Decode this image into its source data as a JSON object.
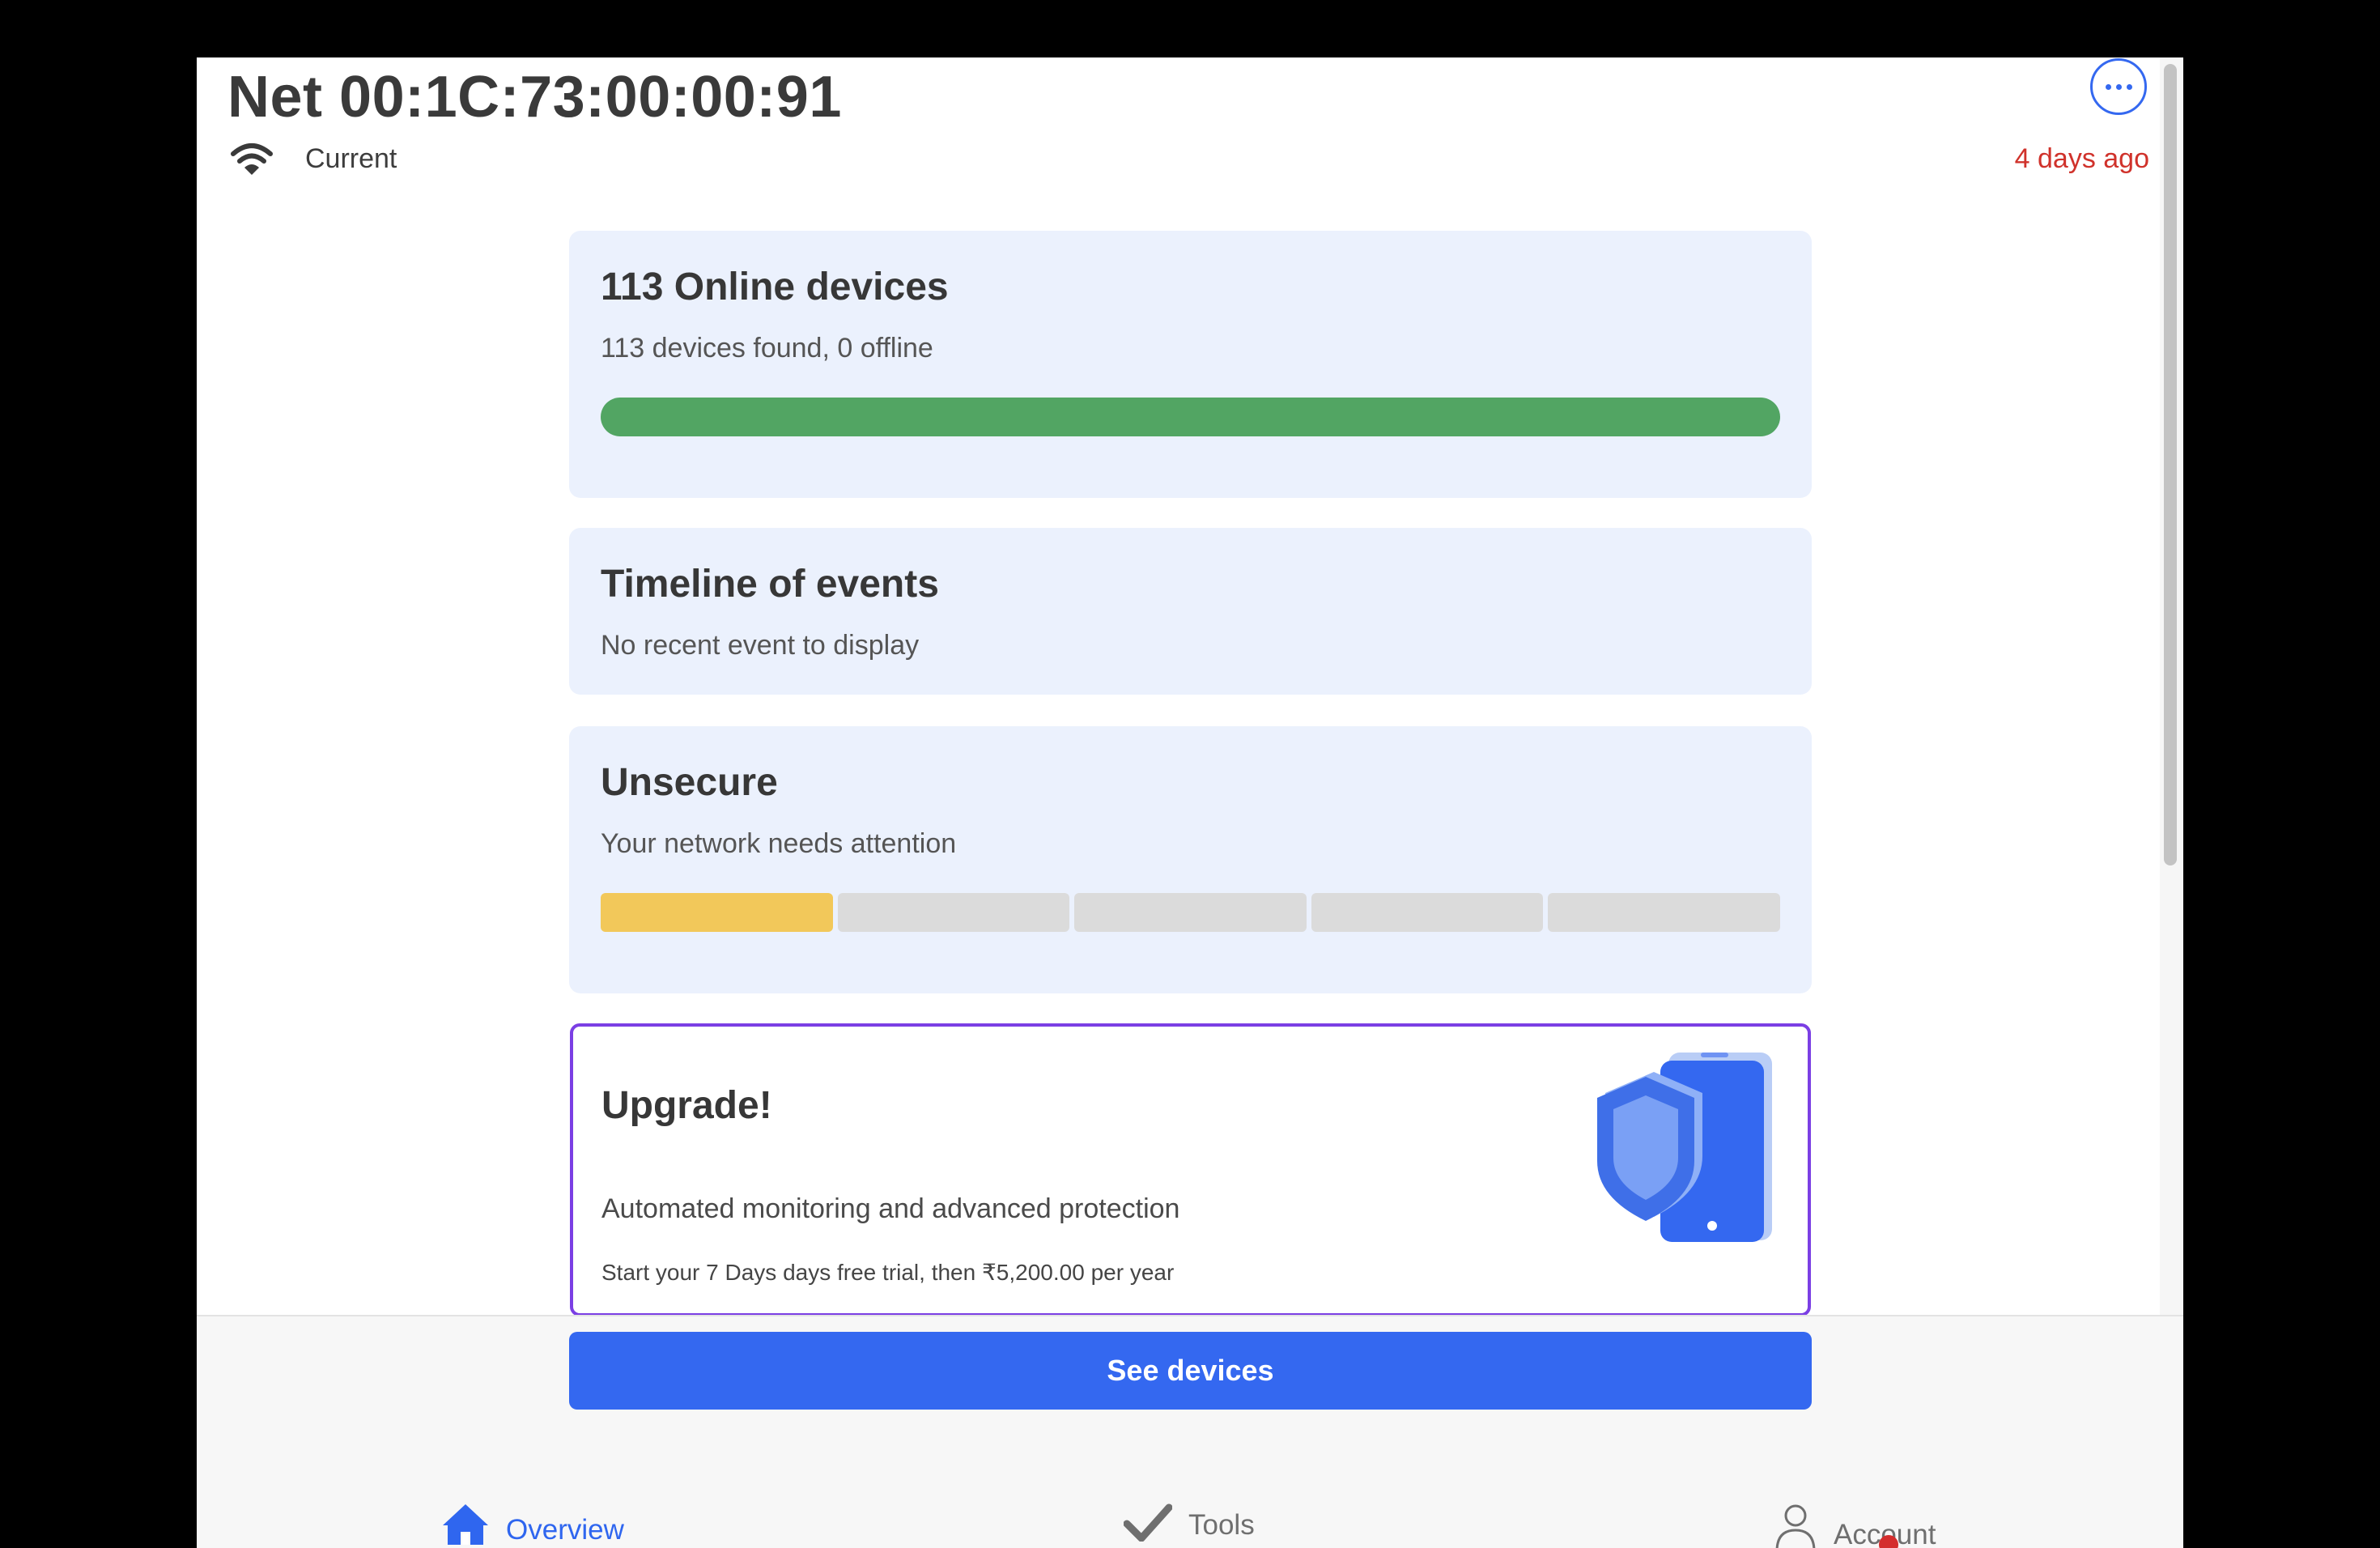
{
  "header": {
    "title": "Net 00:1C:73:00:00:91",
    "connection_label": "Current",
    "last_scan": "4 days ago",
    "icons": {
      "connection": "wifi-icon",
      "more": "more-options-icon"
    }
  },
  "cards": {
    "devices": {
      "title": "113 Online devices",
      "subtitle": "113 devices found, 0 offline",
      "online_fraction": 1.0,
      "bar_color": "#52a563"
    },
    "timeline": {
      "title": "Timeline of events",
      "subtitle": "No recent event to display"
    },
    "security": {
      "title": "Unsecure",
      "subtitle": "Your network needs attention",
      "level": 1,
      "level_max": 5,
      "active_color": "#f2c85a",
      "inactive_color": "#dbdbdb"
    },
    "upgrade": {
      "title": "Upgrade!",
      "description": "Automated monitoring and advanced protection",
      "trial_text": "Start your 7 Days days free trial, then ₹5,200.00 per year",
      "illustration": "shield-phone-icon",
      "border_color": "#7b3fe4"
    }
  },
  "actions": {
    "see_devices_label": "See devices"
  },
  "nav": {
    "items": [
      {
        "label": "Overview",
        "icon": "home-icon",
        "active": true
      },
      {
        "label": "Tools",
        "icon": "checkmark-icon",
        "active": false
      },
      {
        "label": "Account",
        "icon": "person-icon",
        "active": false,
        "has_badge": true
      }
    ]
  },
  "colors": {
    "accent": "#3468f0",
    "alert": "#d0322b",
    "card_background": "#ebf1fd"
  }
}
